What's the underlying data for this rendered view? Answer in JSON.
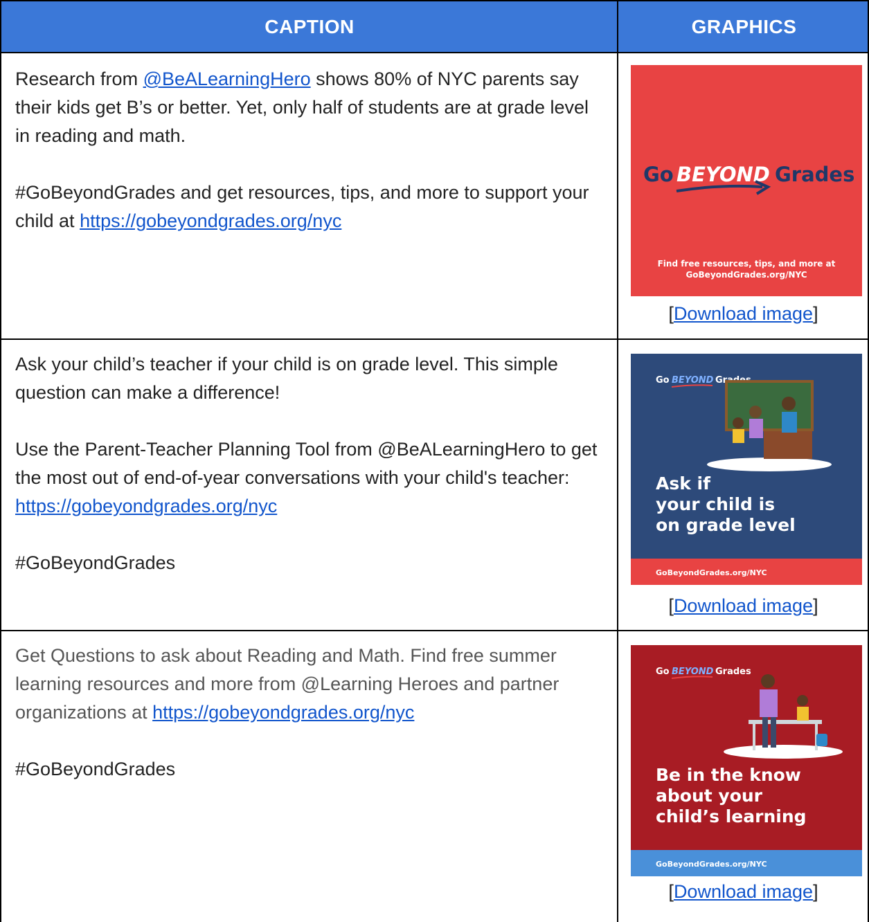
{
  "header": {
    "caption_label": "CAPTION",
    "graphics_label": "GRAPHICS",
    "bg_color": "#3b78d8"
  },
  "rows": [
    {
      "caption": {
        "p1_pre": "Research from ",
        "p1_link": "@BeALearningHero",
        "p1_post": " shows 80% of NYC parents say their kids get B’s or better. Yet, only half of students are at grade level in reading and math.",
        "p2_pre": "#GoBeyondGrades and get resources, tips, and more to support your child at ",
        "p2_link": "https://gobeyondgrades.org/nyc"
      },
      "graphic": {
        "bg_color": "#e84343",
        "logo_go": "Go",
        "logo_beyond": "BEYOND",
        "logo_grades": "Grades",
        "footer_line1": "Find free resources, tips, and more at",
        "footer_line2": "GoBeyondGrades.org/NYC"
      },
      "download": {
        "open": "[",
        "link": "Download image",
        "close": "]"
      }
    },
    {
      "caption": {
        "p1": "Ask your child’s teacher if your child is on grade level. This simple question can make a difference!",
        "p2_pre": "Use the Parent-Teacher Planning Tool from @BeALearningHero to get the most out of end-of-year conversations with your child's teacher: ",
        "p2_link": "https://gobeyondgrades.org/nyc",
        "p3": "#GoBeyondGrades"
      },
      "graphic": {
        "bg_color": "#2d4a7a",
        "band_color": "#e84343",
        "logo_go": "Go",
        "logo_beyond": "BEYOND",
        "logo_grades": "Grades",
        "headline": [
          "Ask if",
          "your child is",
          "on grade level"
        ],
        "band_text": "GoBeyondGrades.org/NYC"
      },
      "download": {
        "open": "[",
        "link": "Download image",
        "close": "]"
      }
    },
    {
      "caption": {
        "p1_pre": "Get Questions to ask about Reading and Math. Find free summer learning resources and more from @Learning Heroes and partner organizations at ",
        "p1_link": "https://gobeyondgrades.org/nyc",
        "p2": "#GoBeyondGrades"
      },
      "graphic": {
        "bg_color": "#a81c24",
        "band_color": "#4a90d9",
        "logo_go": "Go",
        "logo_beyond": "BEYOND",
        "logo_grades": "Grades",
        "headline": [
          "Be in the know",
          "about your",
          "child’s learning"
        ],
        "band_text": "GoBeyondGrades.org/NYC"
      },
      "download": {
        "open": "[",
        "link": "Download image",
        "close": "]"
      }
    }
  ]
}
